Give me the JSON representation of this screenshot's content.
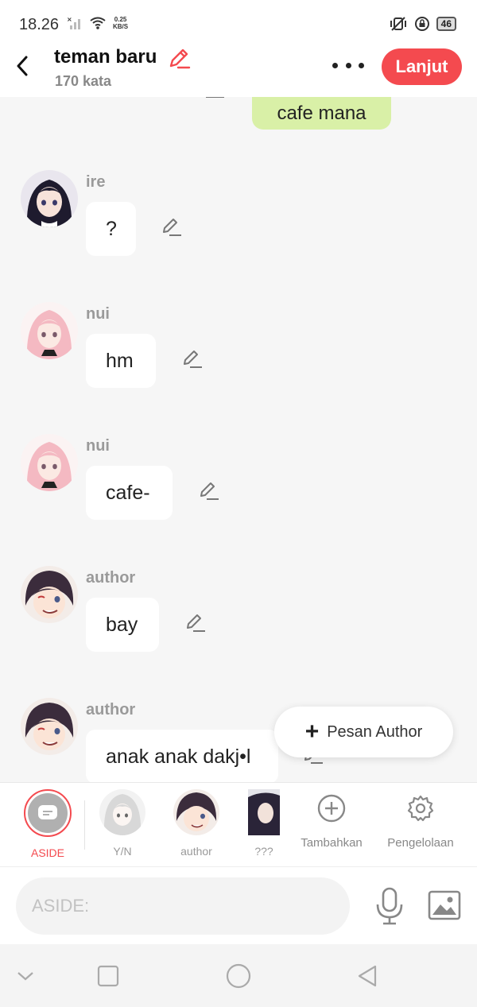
{
  "status_bar": {
    "time": "18.26",
    "net_speed_value": "0.25",
    "net_speed_unit": "KB/S",
    "battery": "46"
  },
  "header": {
    "title": "teman baru",
    "subtitle": "170 kata",
    "next_label": "Lanjut"
  },
  "chat": {
    "top_message": "cafe mana",
    "messages": [
      {
        "name": "ire",
        "text": "?"
      },
      {
        "name": "nui",
        "text": "hm"
      },
      {
        "name": "nui",
        "text": "cafe-"
      },
      {
        "name": "author",
        "text": "bay"
      },
      {
        "name": "author",
        "text": "anak anak dakj•l"
      }
    ]
  },
  "fab": {
    "label": "Pesan Author"
  },
  "characters": [
    {
      "label": "ASIDE"
    },
    {
      "label": "Y/N"
    },
    {
      "label": "author"
    },
    {
      "label": "???"
    }
  ],
  "tools": {
    "add_label": "Tambahkan",
    "manage_label": "Pengelolaan"
  },
  "input": {
    "placeholder": "ASIDE:"
  },
  "colors": {
    "accent": "#f44a4f",
    "right_bubble": "#d9f0a7",
    "background": "#f6f6f6"
  }
}
